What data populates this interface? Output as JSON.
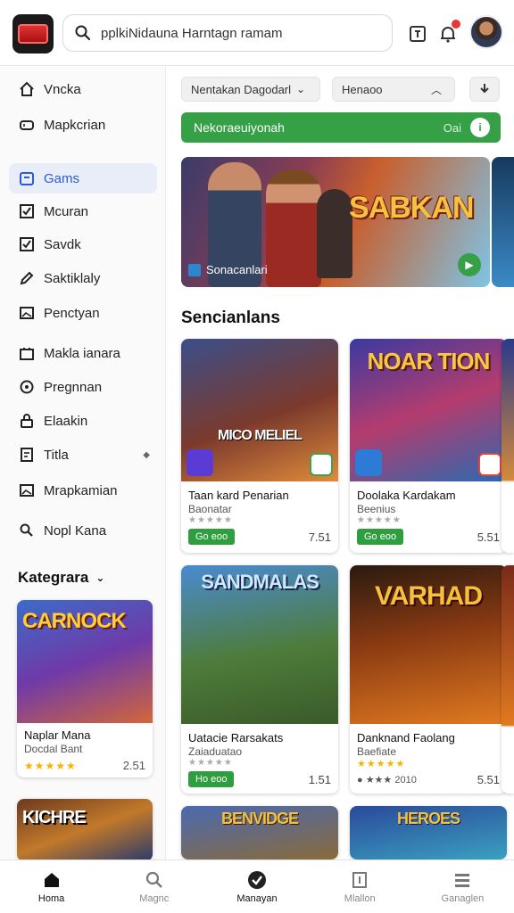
{
  "header": {
    "search_text": "pplkiNidauna  Harntagn ramam"
  },
  "sidebar": {
    "items": [
      {
        "label": "Vncka",
        "icon": "home-icon"
      },
      {
        "label": "Mapkcrian",
        "icon": "gamepad-icon"
      },
      {
        "label": "Gams",
        "icon": "games-icon",
        "active": true
      },
      {
        "label": "Mcuran",
        "icon": "checkbox-icon"
      },
      {
        "label": "Savdk",
        "icon": "checkbox-icon"
      },
      {
        "label": "Saktiklaly",
        "icon": "pen-icon"
      },
      {
        "label": "Penctyan",
        "icon": "image-icon"
      },
      {
        "label": "Makla ianara",
        "icon": "bag-icon"
      },
      {
        "label": "Pregnnan",
        "icon": "cloud-icon"
      },
      {
        "label": "Elaakin",
        "icon": "lock-icon"
      },
      {
        "label": "Titla",
        "icon": "doc-icon"
      },
      {
        "label": "Mrapkamian",
        "icon": "image-icon"
      },
      {
        "label": "Nopl Kana",
        "icon": "search-icon"
      }
    ],
    "category_title": "Kategrara",
    "card": {
      "title": "Naplar Mana",
      "subtitle": "Docdal Bant",
      "stars": "★★★★★",
      "rating": "2.51"
    }
  },
  "filters": {
    "sort": "Nentakan Dagodarl",
    "filter": "Henaoo"
  },
  "promo": {
    "text": "Nekoraeuiyonah",
    "right_text": "Oai"
  },
  "hero": {
    "logo_text": "SABKAN",
    "caption": "Sonacanlari"
  },
  "section_title": "Sencianlans",
  "cards": [
    {
      "title": "Taan kard Penarian",
      "subtitle": "Baonatar",
      "stars": "★★★★★",
      "price": "Go eoo",
      "rating": "7.51",
      "wm": "MICO MELIEL"
    },
    {
      "title": "Doolaka Kardakam",
      "subtitle": "Beenius",
      "stars": "★★★★★",
      "price": "Go eoo",
      "rating": "5.51",
      "wm": "NOAR TION"
    },
    {
      "title": "Uatacie Rarsakats",
      "subtitle": "Zaiaduatao",
      "stars": "★★★★★",
      "price": "Ho eoo",
      "rating": "1.51",
      "wm": "SANDMALAS"
    },
    {
      "title": "Danknand Faolang",
      "subtitle": "Baefiate",
      "stars": "★★★★★",
      "price": "",
      "rating": "5.51",
      "wm": "VARHAD"
    }
  ],
  "bottom_nav": [
    {
      "label": "Homa",
      "icon": "home-icon",
      "active": true
    },
    {
      "label": "Magnc",
      "icon": "search-icon"
    },
    {
      "label": "Manayan",
      "icon": "check-circle-icon"
    },
    {
      "label": "Mlallon",
      "icon": "doc-icon"
    },
    {
      "label": "Ganaglen",
      "icon": "grid-icon"
    }
  ]
}
